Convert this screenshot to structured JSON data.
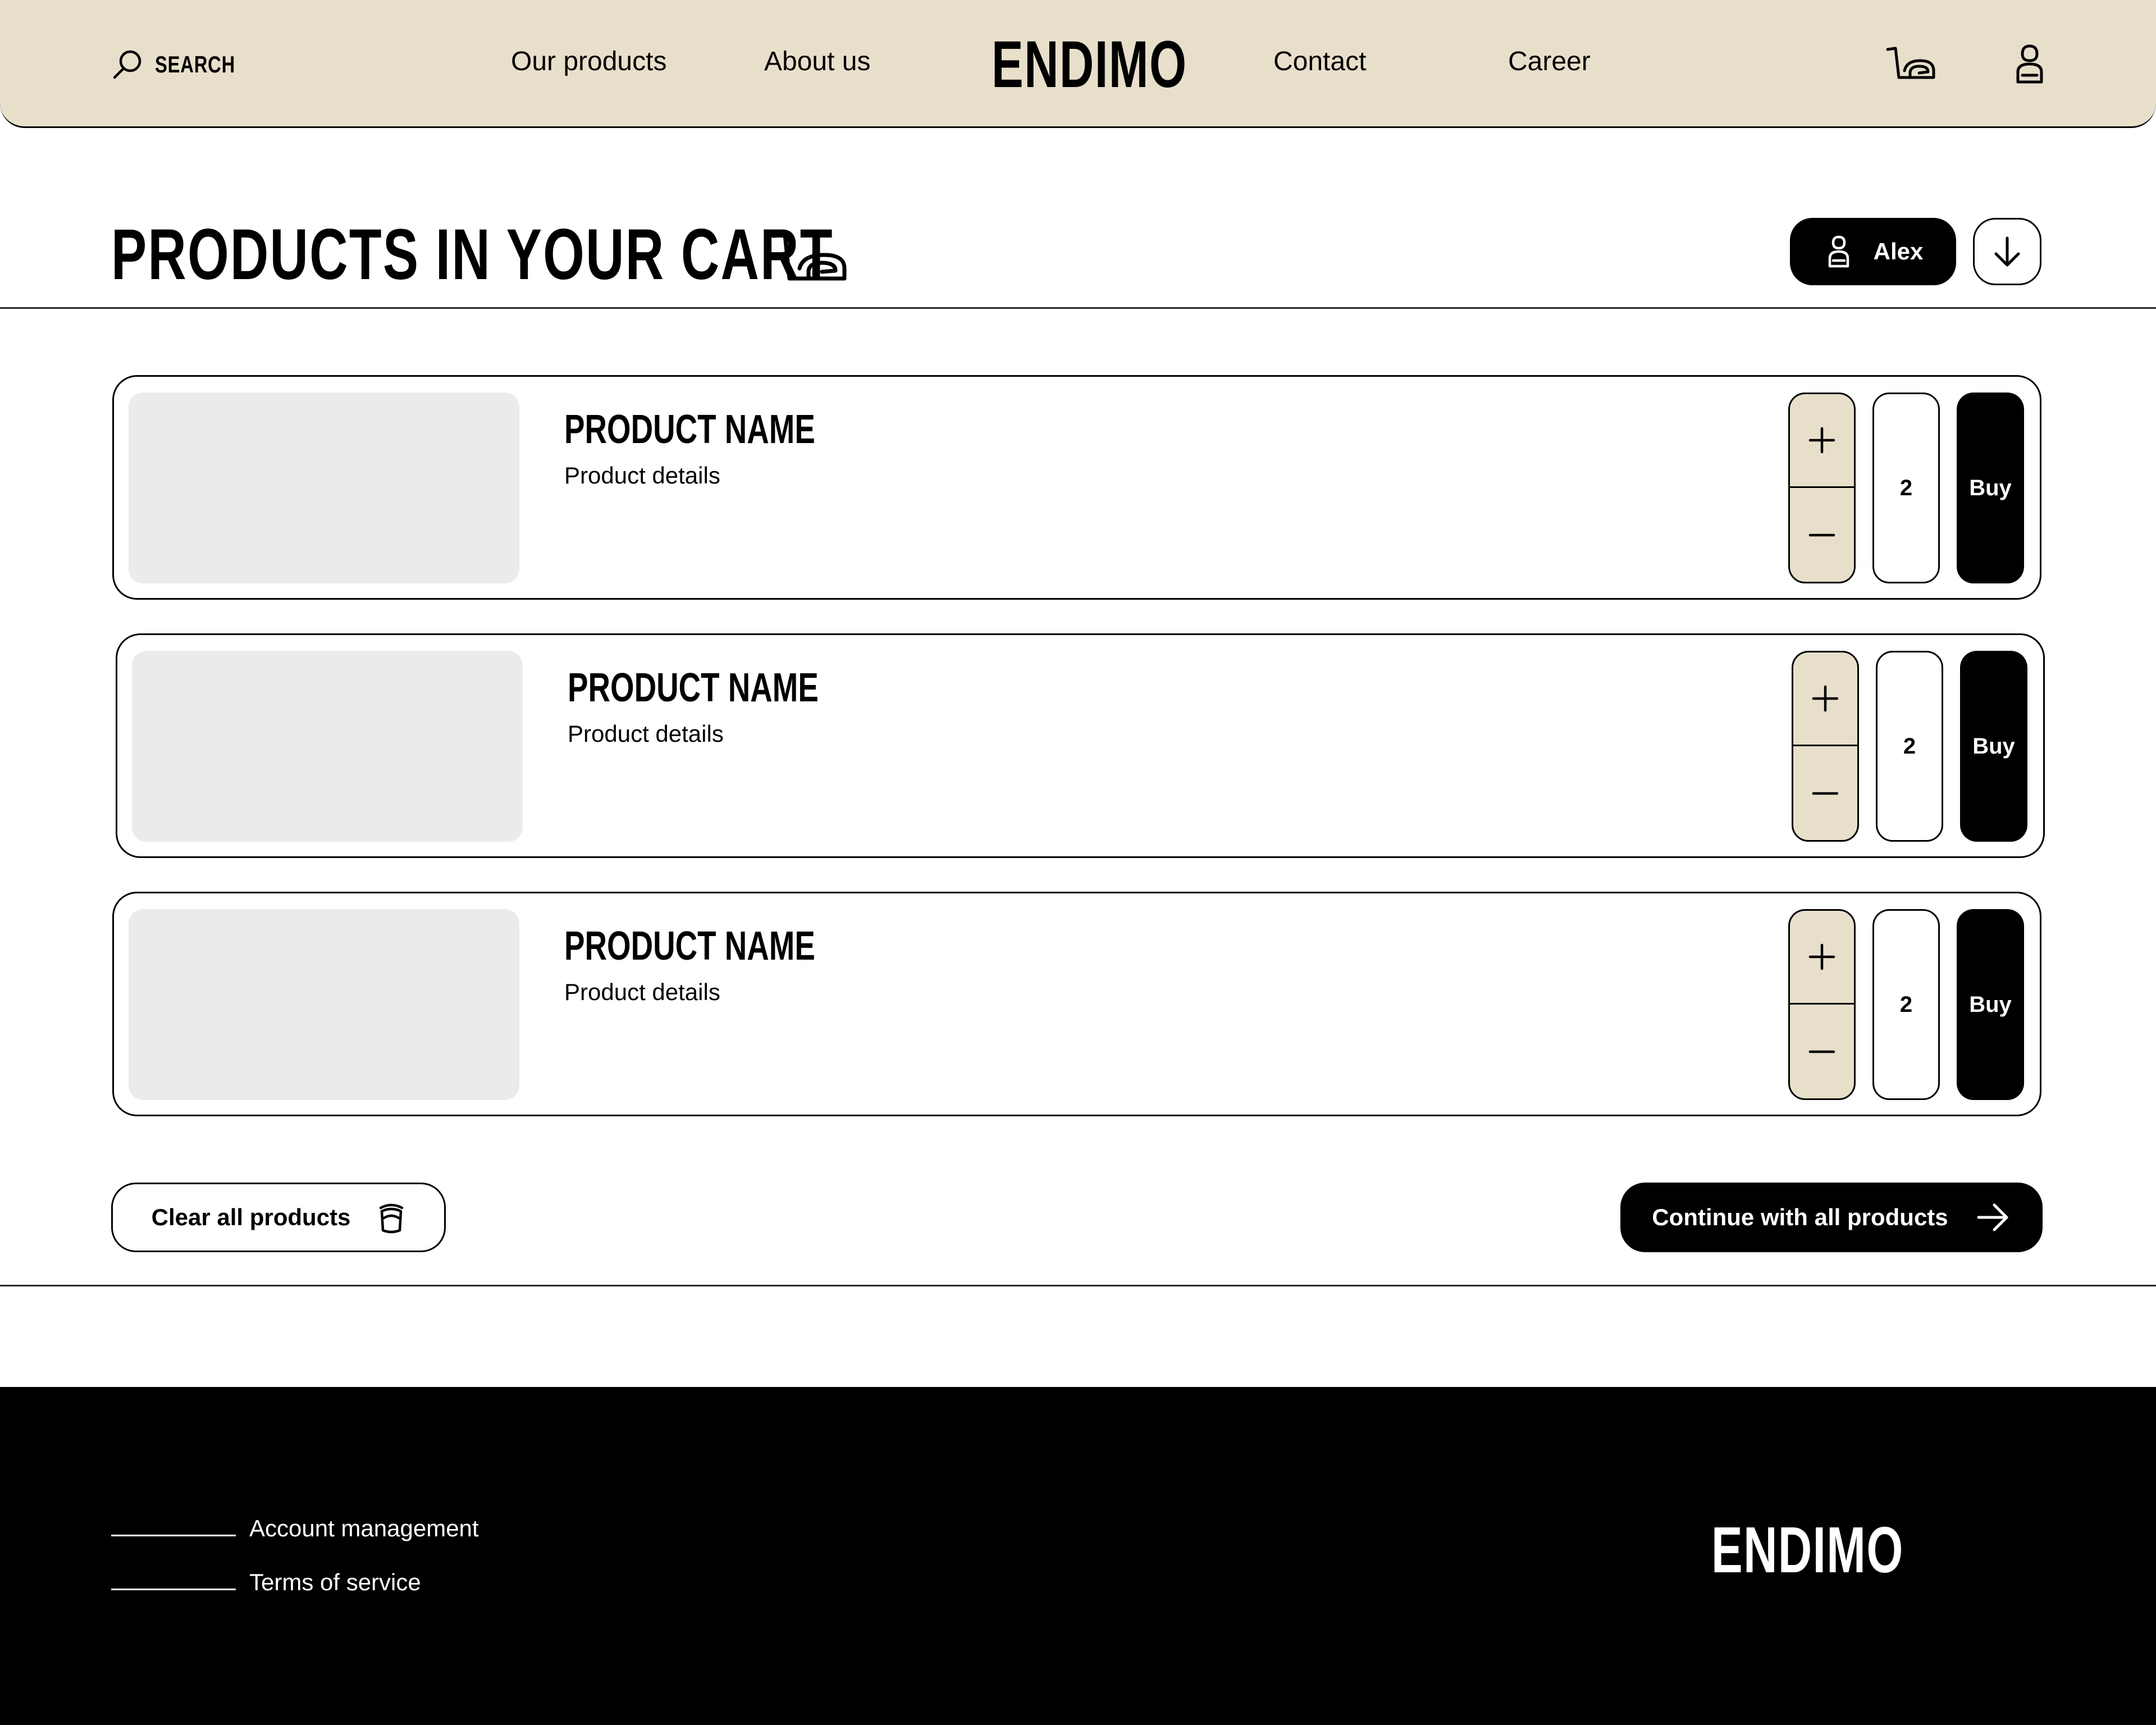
{
  "header": {
    "search_label": "SEARCH",
    "nav": [
      "Our products",
      "About us",
      "Contact",
      "Career"
    ],
    "logo": "ENDIMO",
    "icons": [
      "search-icon",
      "cart-icon",
      "user-icon"
    ]
  },
  "cart": {
    "title": "PRODUCTS IN YOUR CART",
    "user_name": "Alex",
    "items": [
      {
        "name": "PRODUCT NAME",
        "details": "Product details",
        "quantity": "2",
        "buy_label": "Buy"
      },
      {
        "name": "PRODUCT NAME",
        "details": "Product details",
        "quantity": "2",
        "buy_label": "Buy"
      },
      {
        "name": "PRODUCT NAME",
        "details": "Product details",
        "quantity": "2",
        "buy_label": "Buy"
      }
    ],
    "clear_label": "Clear all products",
    "continue_label": "Continue with all products"
  },
  "footer": {
    "links": [
      "Account management",
      "Terms of service"
    ],
    "logo": "ENDIMO"
  },
  "colors": {
    "accent_beige": "#e8dfcb",
    "primary": "#000000",
    "image_placeholder": "#ebebeb"
  }
}
